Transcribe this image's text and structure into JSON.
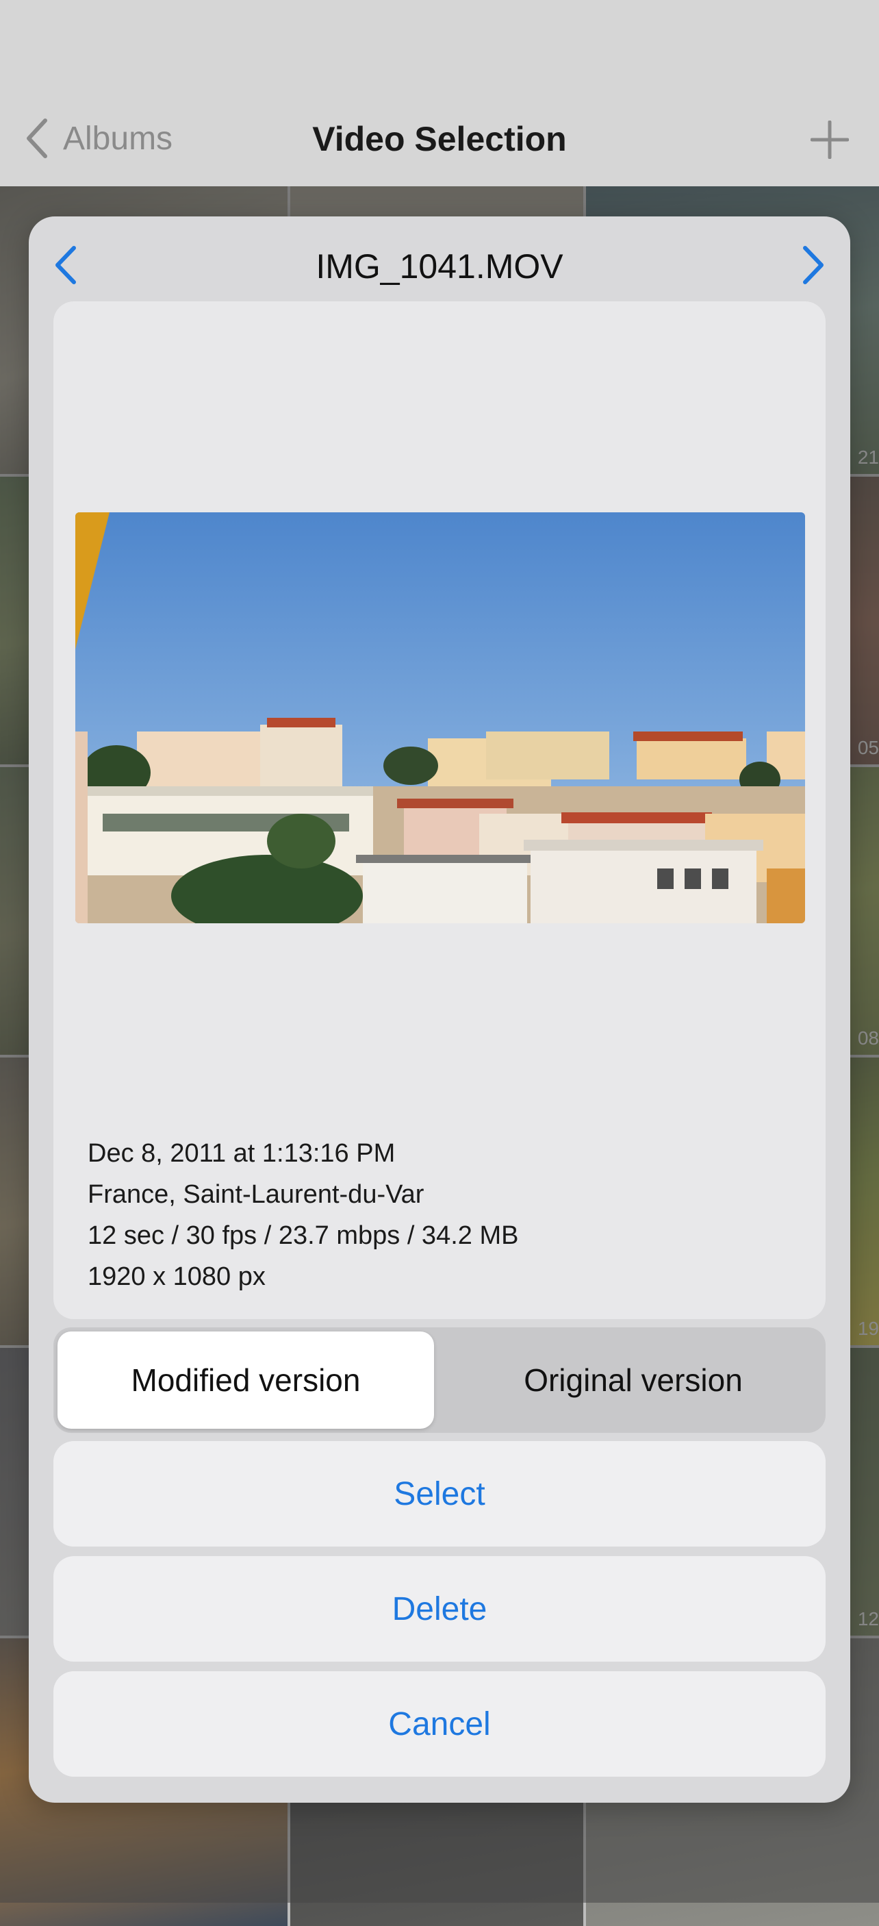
{
  "nav": {
    "back_label": "Albums",
    "title": "Video Selection"
  },
  "background": {
    "tile_numbers": [
      "21",
      "05",
      "08",
      "19",
      "12"
    ]
  },
  "sheet": {
    "file_name": "IMG_1041.MOV",
    "metadata": {
      "date": "Dec 8, 2011 at 1:13:16 PM",
      "location": "France, Saint-Laurent-du-Var",
      "stats": "12 sec / 30 fps / 23.7 mbps / 34.2 MB",
      "resolution": "1920 x 1080 px"
    },
    "segmented": {
      "modified_label": "Modified version",
      "original_label": "Original version",
      "selected": "Modified version"
    },
    "actions": {
      "select_label": "Select",
      "delete_label": "Delete",
      "cancel_label": "Cancel"
    }
  },
  "colors": {
    "accent": "#1e78e0",
    "sheet_bg": "#d9d9db"
  }
}
